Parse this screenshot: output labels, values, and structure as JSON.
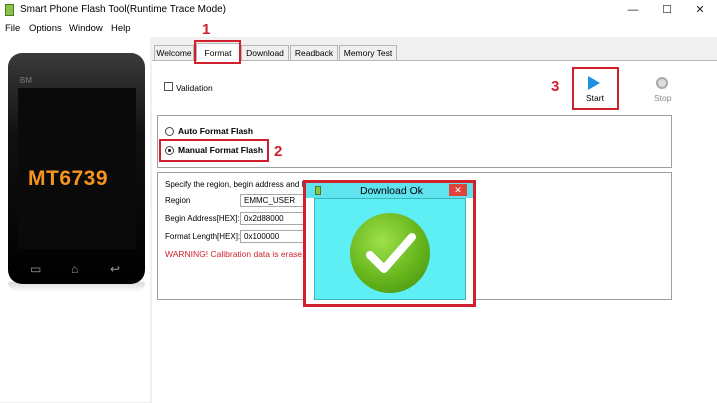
{
  "window": {
    "title": "Smart Phone Flash Tool(Runtime Trace Mode)",
    "minimize_glyph": "—",
    "maximize_glyph": "☐",
    "close_glyph": "✕"
  },
  "menu": [
    "File",
    "Options",
    "Window",
    "Help"
  ],
  "phone": {
    "bm_label": "BM",
    "model": "MT6739",
    "soft_buttons": [
      "▭",
      "⌂",
      "↩"
    ]
  },
  "tabs": [
    "Welcome",
    "Format",
    "Download",
    "Readback",
    "Memory Test"
  ],
  "annotations": [
    "1",
    "2",
    "3"
  ],
  "format": {
    "validation_label": "Validation",
    "start_label": "Start",
    "stop_label": "Stop",
    "radio_auto": "Auto Format Flash",
    "radio_manual": "Manual Format Flash",
    "selected": "Manual Format Flash",
    "region_intro": "Specify the region, begin address and len",
    "region_label": "Region",
    "region_value": "EMMC_USER",
    "begin_label": "Begin Address[HEX]:",
    "begin_value": "0x2d88000",
    "length_label": "Format Length[HEX]:",
    "length_value": "0x100000",
    "warning": "WARNING! Calibration data is erase"
  },
  "popup": {
    "title": "Download Ok",
    "close_glyph": "✕"
  },
  "colors": {
    "accent_red": "#d0202e",
    "start_blue": "#1e90e0",
    "popup_bg": "#5eeff4",
    "check_green": "#66b51c",
    "model_orange": "#f7941d"
  },
  "icons": [
    "app-icon",
    "start-play-icon",
    "stop-icon",
    "checkmark-icon",
    "popup-app-icon"
  ]
}
